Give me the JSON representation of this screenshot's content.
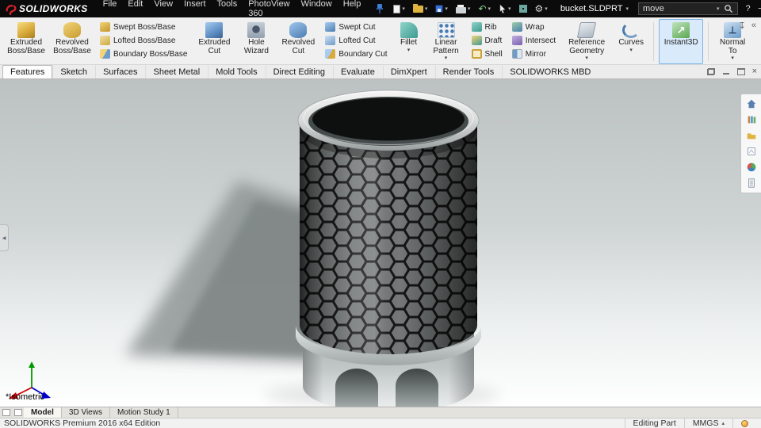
{
  "colors": {
    "brand_red": "#d2232a",
    "titlebar_bg": "#0b0b0b",
    "active_tool_bg": "#d9ebfb",
    "viewport_top_gray": "#bcc1c1"
  },
  "title_bar": {
    "logo_text": "SOLIDWORKS",
    "menus": [
      "File",
      "Edit",
      "View",
      "Insert",
      "Tools",
      "PhotoView 360",
      "Window",
      "Help"
    ],
    "document_title": "bucket.SLDPRT",
    "search_value": "move",
    "help_label": "?"
  },
  "ribbon": {
    "big": [
      {
        "label": "Extruded Boss/Base"
      },
      {
        "label": "Revolved Boss/Base"
      },
      {
        "label": "Extruded Cut"
      },
      {
        "label": "Hole Wizard"
      },
      {
        "label": "Revolved Cut"
      },
      {
        "label": "Fillet"
      },
      {
        "label": "Linear Pattern"
      },
      {
        "label": "Reference Geometry"
      },
      {
        "label": "Curves"
      },
      {
        "label": "Instant3D"
      },
      {
        "label": "Normal To"
      }
    ],
    "stacks": [
      [
        "Swept Boss/Base",
        "Lofted Boss/Base",
        "Boundary Boss/Base"
      ],
      [
        "Swept Cut",
        "Lofted Cut",
        "Boundary Cut"
      ],
      [
        "Rib",
        "Draft",
        "Shell"
      ],
      [
        "Wrap",
        "Intersect",
        "Mirror"
      ]
    ]
  },
  "tabs": [
    "Features",
    "Sketch",
    "Surfaces",
    "Sheet Metal",
    "Mold Tools",
    "Direct Editing",
    "Evaluate",
    "DimXpert",
    "Render Tools",
    "SOLIDWORKS MBD"
  ],
  "viewport": {
    "view_label": "*Isometric"
  },
  "bottom_tabs": [
    "Model",
    "3D Views",
    "Motion Study 1"
  ],
  "status_bar": {
    "left_text": "SOLIDWORKS Premium 2016 x64 Edition",
    "editing_label": "Editing Part",
    "units_label": "MMGS"
  },
  "glyphs": {
    "caret_down": "▾",
    "caret_up": "▴",
    "undo": "↶",
    "gear": "⚙",
    "close": "×",
    "minimize": "─",
    "collapse_left": "◀",
    "chevrons": "«",
    "pin_arrow": "↧",
    "normal_to_glyph": "⊥",
    "instant3d_glyph": "↗"
  }
}
